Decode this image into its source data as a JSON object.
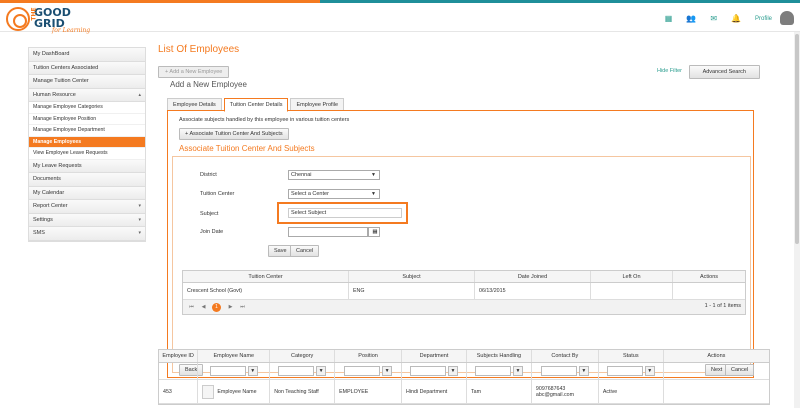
{
  "brand": {
    "line1": "GOOD",
    "line2": "GRID",
    "the": "THE",
    "tagline": "for Learning"
  },
  "top_nav": {
    "profile": "Profile"
  },
  "sidebar": {
    "items": [
      {
        "label": "My DashBoard"
      },
      {
        "label": "Tuition Centers Associated"
      },
      {
        "label": "Manage Tuition Center"
      },
      {
        "label": "Human Resource",
        "arrow": "▴"
      }
    ],
    "sub_items": [
      {
        "label": "Manage Employee Categories"
      },
      {
        "label": "Manage Employee Position"
      },
      {
        "label": "Manage Employee Department"
      },
      {
        "label": "Manage Employees"
      },
      {
        "label": "View Employee Leave Requests"
      }
    ],
    "items_after": [
      {
        "label": "My Leave Requests"
      },
      {
        "label": "Documents"
      },
      {
        "label": "My Calendar"
      },
      {
        "label": "Report Center",
        "arrow": "▾"
      },
      {
        "label": "Settings",
        "arrow": "▾"
      },
      {
        "label": "SMS",
        "arrow": "▾"
      }
    ]
  },
  "main": {
    "title": "List Of Employees",
    "add_button": "+ Add a New Employee",
    "subtitle": "Add a New Employee",
    "hide_filter": "Hide Filter",
    "advanced_search": "Advanced Search",
    "tabs": [
      {
        "label": "Employee Details"
      },
      {
        "label": "Tuition Center Details"
      },
      {
        "label": "Employee Profile"
      }
    ],
    "panel_desc": "Associate subjects handled by this employee in various tuition centers",
    "assoc_button": "Associate Tuition Center And Subjects",
    "assoc_title": "Associate Tuition Center And Subjects",
    "form": {
      "district_label": "District",
      "district_value": "Chennai",
      "center_label": "Tuition Center",
      "center_value": "Select a Center",
      "subject_label": "Subject",
      "subject_value": "Select Subject",
      "join_label": "Join Date",
      "save": "Save",
      "cancel": "Cancel"
    },
    "grid": {
      "headers": [
        "Tuition Center",
        "Subject",
        "Date Joined",
        "Left On",
        "Actions"
      ],
      "rows": [
        [
          "Crescent School (Govt)",
          "ENG",
          "06/13/2015",
          "",
          ""
        ]
      ],
      "current_page": "1",
      "page_info": "1 - 1 of 1 items"
    },
    "back": "Back",
    "next": "Next",
    "cancel": "Cancel"
  },
  "employees": {
    "headers": [
      "Employee ID",
      "Employee Name",
      "Category",
      "Position",
      "Department",
      "Subjects Handling",
      "Contact By",
      "Status",
      "Actions"
    ],
    "rows": [
      {
        "id": "453",
        "name": "Employee Name",
        "category": "Non Teaching Staff",
        "position": "EMPLOYEE",
        "department": "Hindi Department",
        "subjects": "Tam",
        "phone": "9097687643",
        "email": "abc@gmail.com",
        "status": "Active"
      }
    ]
  }
}
